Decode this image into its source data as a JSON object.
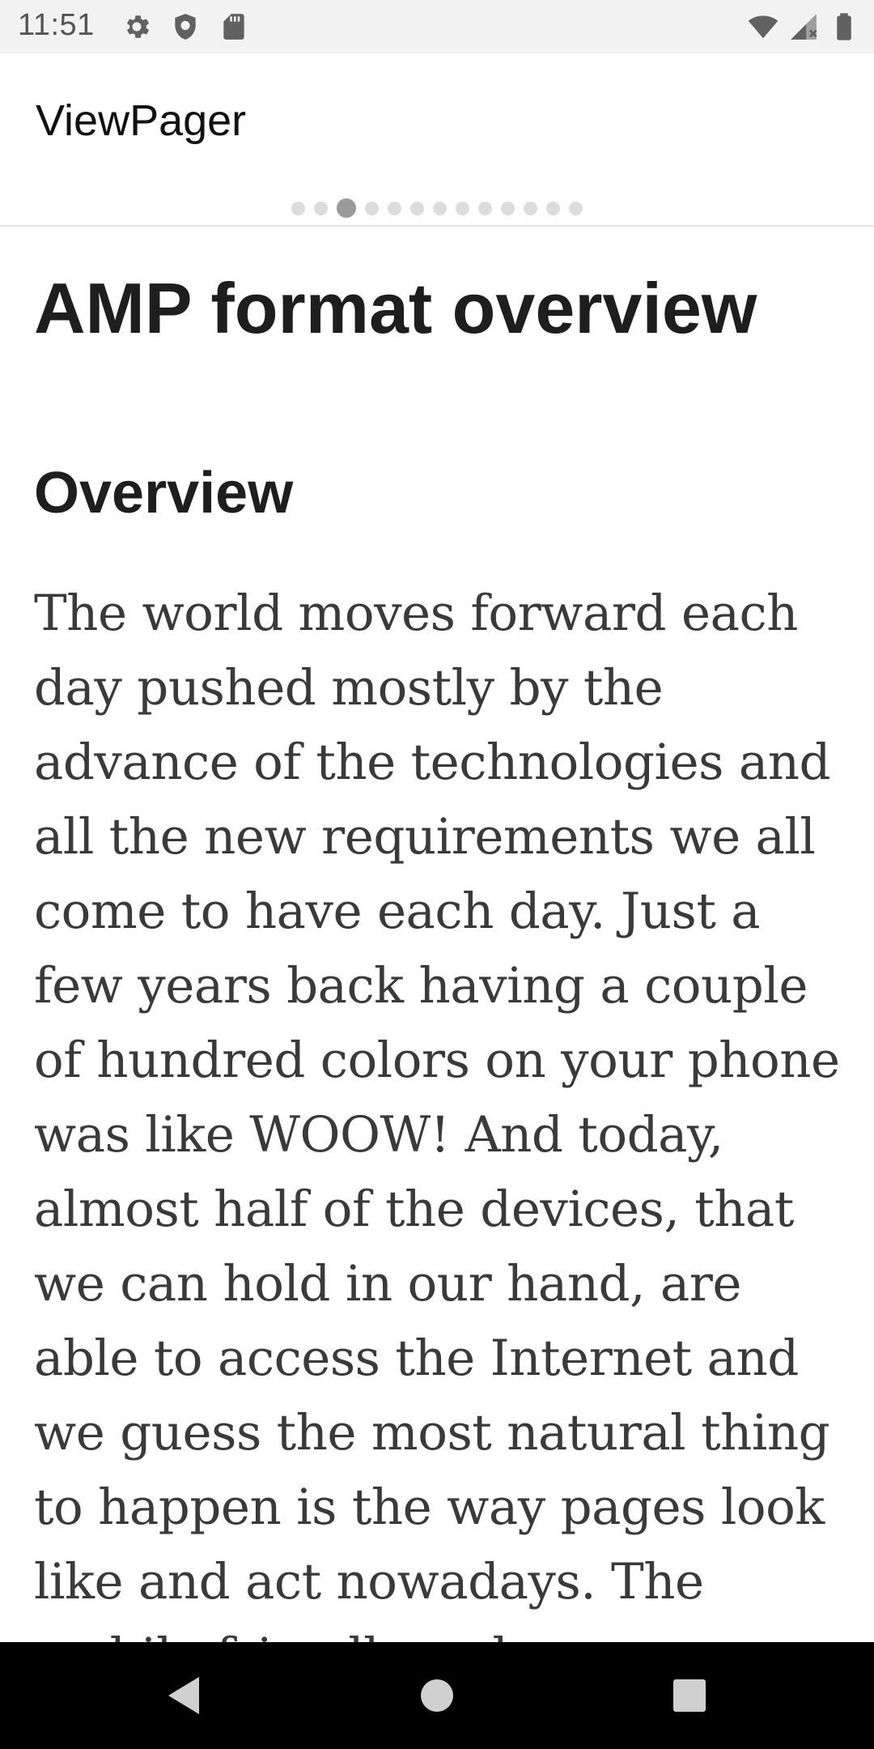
{
  "status_bar": {
    "time": "11:51",
    "left_icons": [
      "settings-icon",
      "shield-icon",
      "sd-card-icon"
    ],
    "right_icons": [
      "wifi-icon",
      "cell-signal-icon",
      "battery-icon"
    ]
  },
  "app_bar": {
    "title": "ViewPager",
    "page_indicator": {
      "count": 13,
      "active_index": 2
    }
  },
  "content": {
    "title": "AMP format overview",
    "section_heading": "Overview",
    "body": "The world moves forward each day pushed mostly by the advance of the technologies and all the new requirements we all come to have each day. Just a few years back having a couple of hundred colors on your phone was like WOOW! And today, almost half of the devices, that we can hold in our hand, are able to access the Internet and we guess the most natural thing to happen is the way pages look like and act nowadays. The mobile friendly web pages are on the rise and"
  },
  "navigation_bar": {
    "buttons": [
      "back-icon",
      "home-icon",
      "recents-icon"
    ]
  },
  "colors": {
    "status_bar_bg": "#f2f2f2",
    "nav_bar_bg": "#000000",
    "dot_inactive": "#dcdcdc",
    "dot_active": "#9a9a9a",
    "text_primary": "#1e1e1e",
    "text_body": "#3a3a3a"
  }
}
